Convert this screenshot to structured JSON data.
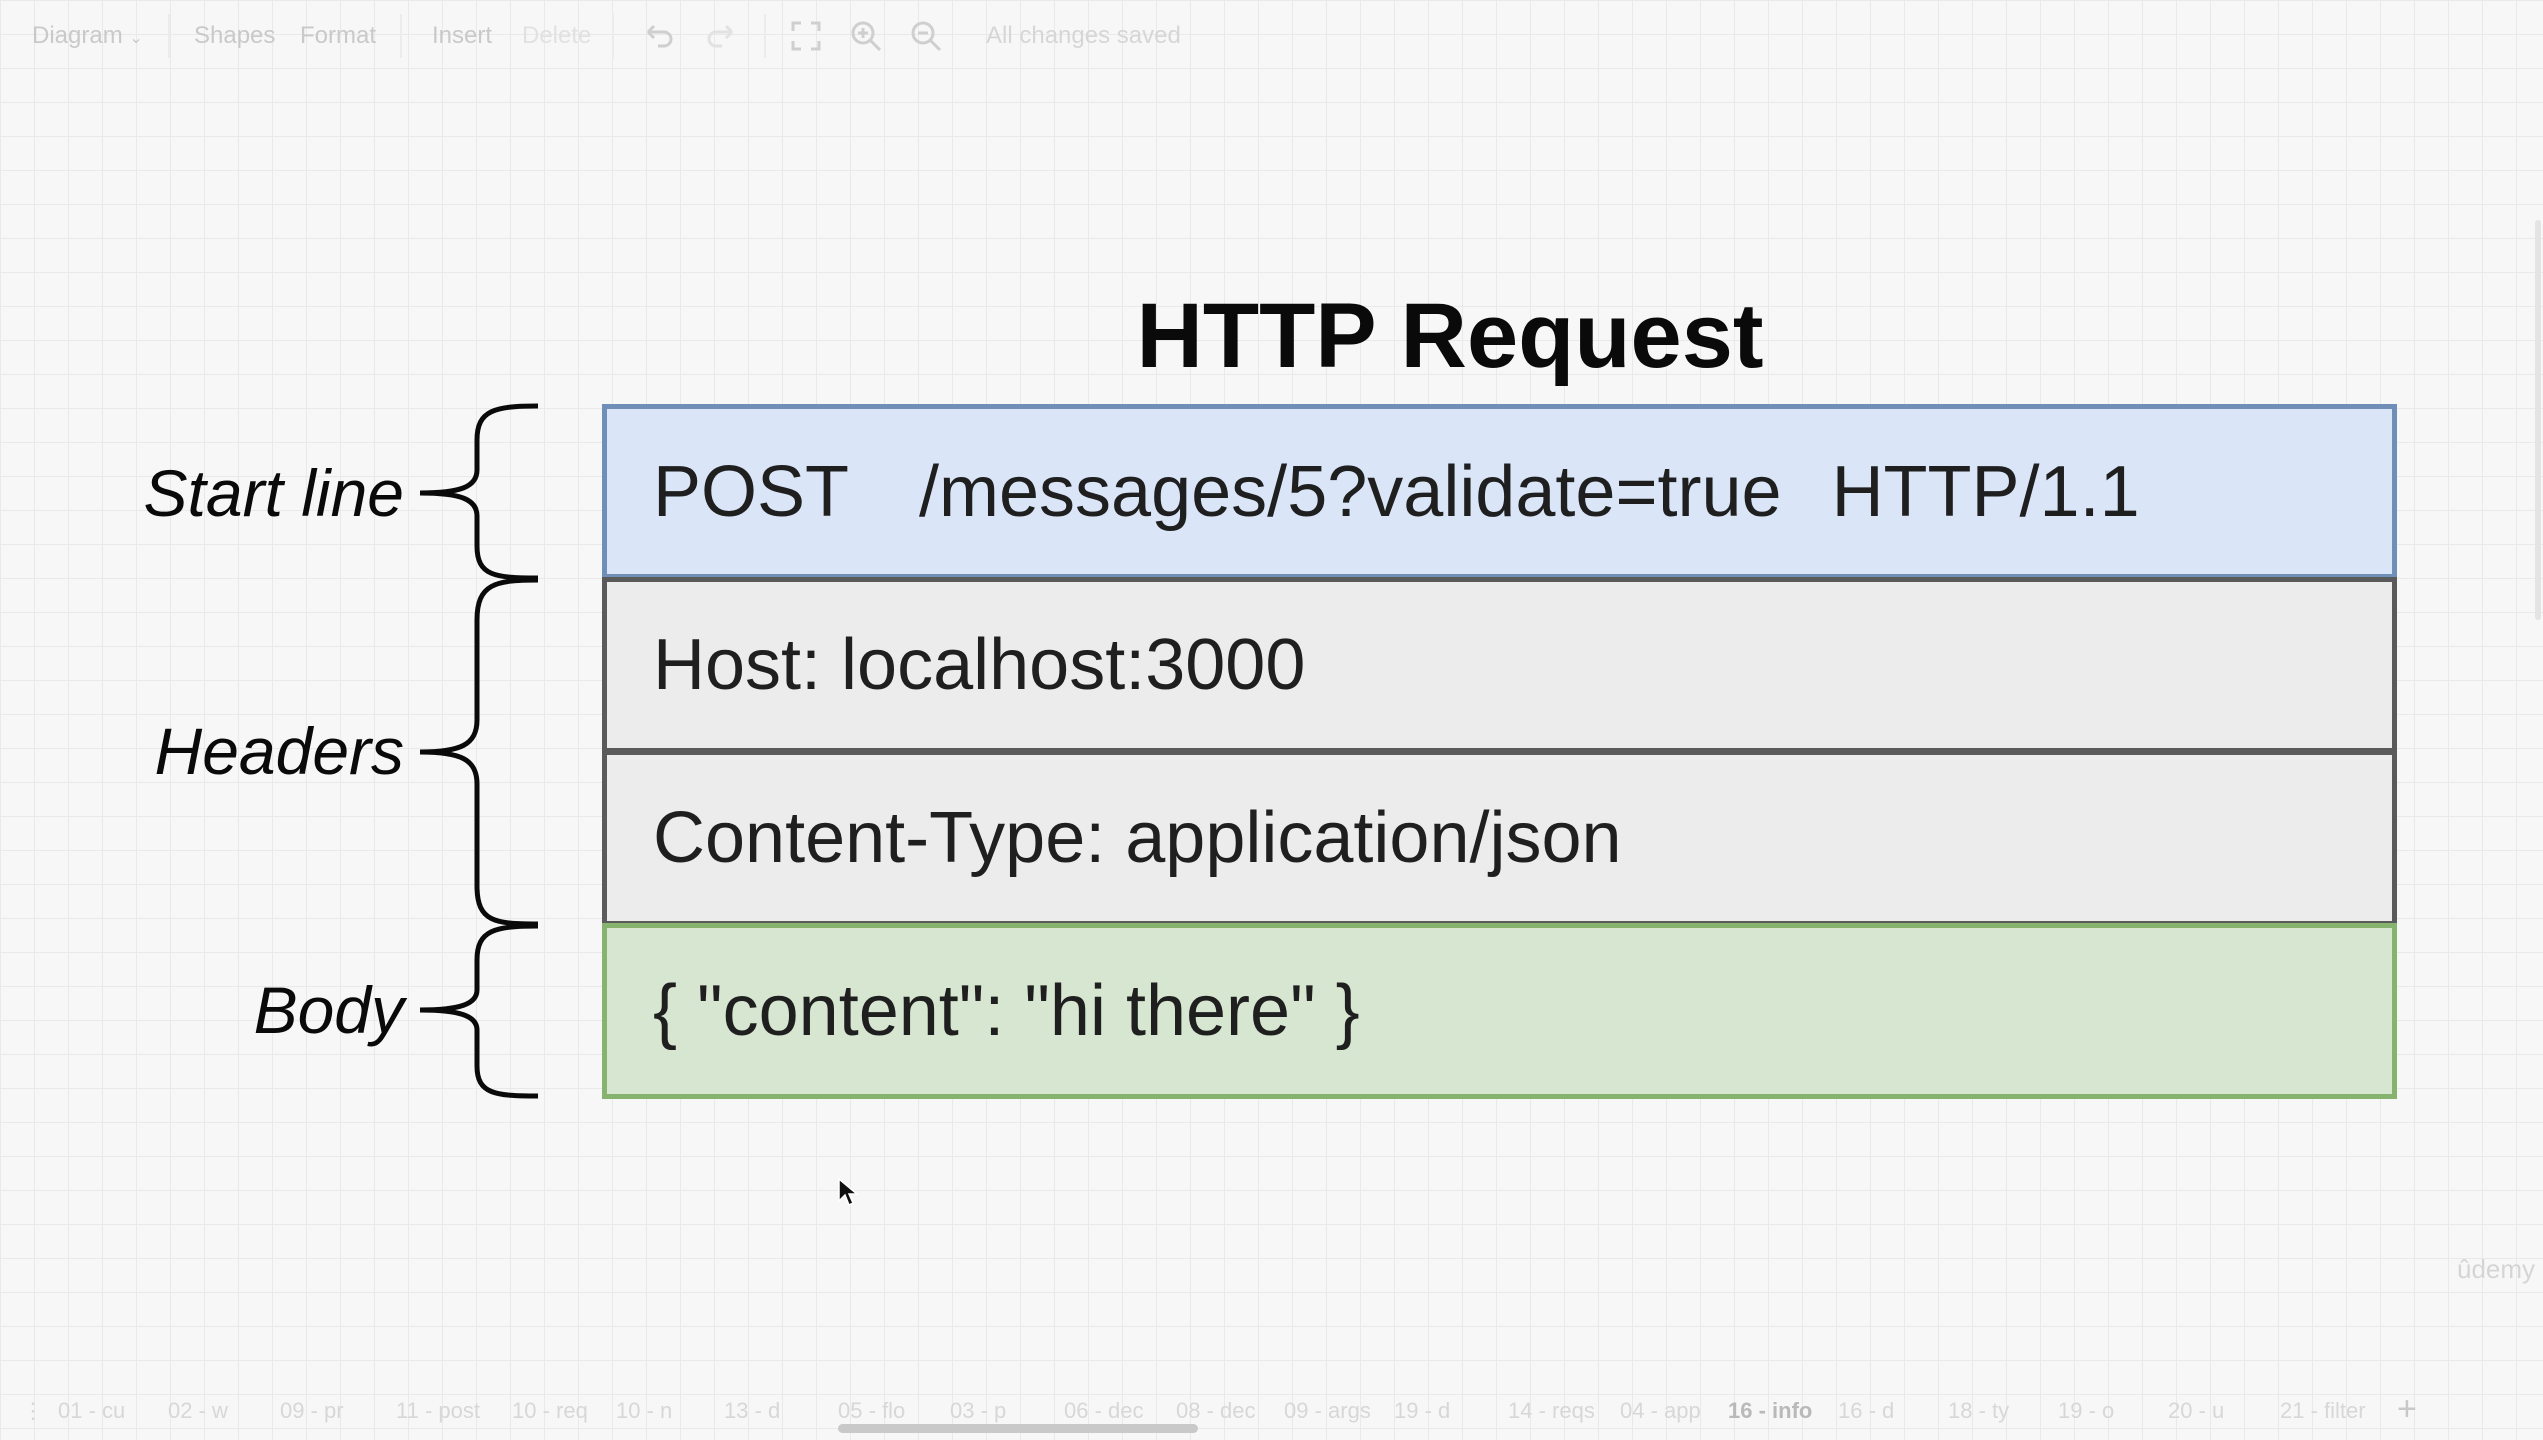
{
  "toolbar": {
    "diagram_label": "Diagram",
    "diagram_chevron": "chevron-down-icon",
    "shapes_label": "Shapes",
    "format_label": "Format",
    "insert_label": "Insert",
    "delete_label": "Delete",
    "status_text": "All changes saved",
    "icons": [
      "undo-icon",
      "redo-icon",
      "fullscreen-icon",
      "zoom-in-icon",
      "zoom-out-icon"
    ]
  },
  "diagram": {
    "title": "HTTP Request",
    "start_line": {
      "label": "Start line",
      "method": "POST",
      "path": "/messages/5?validate=true",
      "version": "HTTP/1.1",
      "color": "#dae6f8"
    },
    "headers": {
      "label": "Headers",
      "items": [
        "Host: localhost:3000",
        "Content-Type: application/json"
      ],
      "color": "#ececec"
    },
    "body": {
      "label": "Body",
      "content": "{ \"content\": \"hi there\" }",
      "color": "#d6e6d0"
    }
  },
  "tabs": {
    "items": [
      "01 - cu",
      "02 - w",
      "09 - pr",
      "11 - post",
      "10 - req",
      "10 - n",
      "13 - d",
      "05 - flo",
      "03 - p",
      "06 - dec",
      "08 - dec",
      "09 - args",
      "19 - d",
      "14 - reqs",
      "04 - app",
      "16 - info",
      "16 - d",
      "18 - ty",
      "19 - o",
      "20 - u",
      "21 - filter"
    ],
    "active": "16 - info"
  },
  "watermark": "ûdemy"
}
